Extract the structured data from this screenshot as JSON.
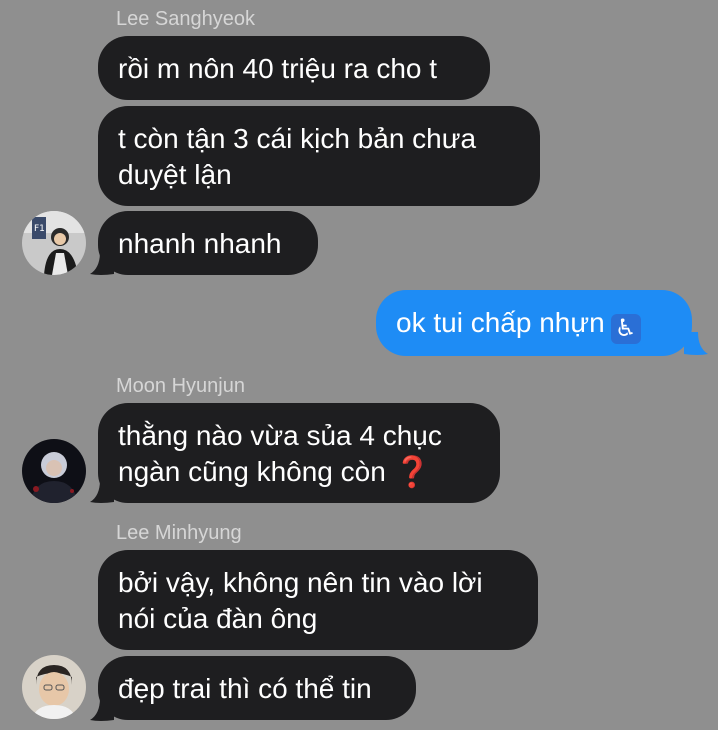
{
  "conversation": {
    "groups": [
      {
        "sender": "Lee Sanghyeok",
        "avatar_icon": "person-photo-icon",
        "messages": [
          "rồi m nôn 40 triệu ra cho t",
          "t còn tận 3 cái kịch bản chưa duyệt lận",
          "nhanh nhanh"
        ]
      },
      {
        "outgoing": true,
        "messages": [
          "ok tui chấp nhựn"
        ],
        "emoji": "♿"
      },
      {
        "sender": "Moon Hyunjun",
        "avatar_icon": "person-photo-icon",
        "messages": [
          "thằng nào vừa sủa 4 chục ngàn cũng không còn"
        ],
        "emoji": "❓"
      },
      {
        "sender": "Lee Minhyung",
        "avatar_icon": "person-photo-icon",
        "messages": [
          "bởi vậy, không nên tin vào lời nói của đàn ông",
          "đẹp trai thì có thể tin"
        ]
      }
    ]
  },
  "colors": {
    "background": "#8f8f8f",
    "incoming_bubble": "#1e1e20",
    "outgoing_bubble": "#1e8cf5",
    "sender_name": "#d6d6d6"
  }
}
